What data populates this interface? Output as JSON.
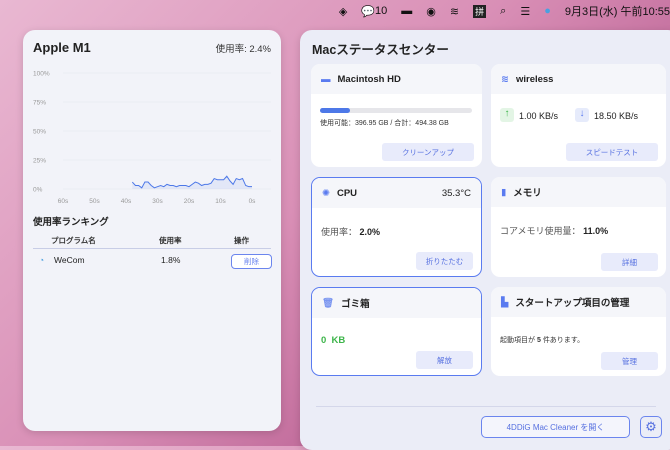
{
  "menubar": {
    "notif_count": "10",
    "clock": "9月3日(水) 午前10:55"
  },
  "left": {
    "title": "Apple M1",
    "usage": "使用率: 2.4%",
    "ranking_title": "使用率ランキング",
    "columns": [
      "プログラム名",
      "使用率",
      "操作"
    ],
    "rows": [
      {
        "name": "WeCom",
        "usage": "1.8%",
        "action": "削除"
      }
    ]
  },
  "chart_data": {
    "type": "area",
    "title": "Apple M1",
    "xlabel": "",
    "ylabel": "",
    "y_ticks": [
      "100%",
      "75%",
      "50%",
      "25%",
      "0%"
    ],
    "x_ticks": [
      "60s",
      "50s",
      "40s",
      "30s",
      "20s",
      "10s",
      "0s"
    ],
    "ylim": [
      0,
      100
    ],
    "xlim": [
      60,
      0
    ],
    "x": [
      38,
      37,
      36,
      35,
      34,
      33,
      32,
      31,
      30,
      29,
      28,
      27,
      26,
      25,
      24,
      23,
      22,
      21,
      20,
      19,
      18,
      17,
      16,
      15,
      14,
      13,
      12,
      11,
      10,
      9,
      8,
      7,
      6,
      5,
      4,
      3,
      2,
      1,
      0
    ],
    "values": [
      6,
      3,
      3,
      1,
      6,
      6,
      3,
      1,
      2,
      3,
      2,
      4,
      3,
      3,
      2,
      3,
      3,
      3,
      2,
      4,
      6,
      5,
      3,
      4,
      4,
      5,
      9,
      8,
      8,
      8,
      11,
      7,
      4,
      9,
      8,
      9,
      3,
      2,
      2
    ]
  },
  "right": {
    "title": "Macステータスセンター",
    "disk": {
      "name": "Macintosh HD",
      "used_fraction": 0.197,
      "info": "使用可能：396.95 GB / 合計：494.38 GB",
      "button": "クリーンアップ"
    },
    "wireless": {
      "name": "wireless",
      "up": "1.00 KB/s",
      "down": "18.50 KB/s",
      "button": "スピードテスト"
    },
    "cpu": {
      "name": "CPU",
      "temp": "35.3°C",
      "usage_label": "使用率：",
      "usage": "2.0%",
      "button": "折りたたむ"
    },
    "memory": {
      "name": "メモリ",
      "label": "コアメモリ使用量：",
      "value": "11.0%",
      "button": "詳細"
    },
    "trash": {
      "name": "ゴミ箱",
      "value": "0  KB",
      "button": "解放"
    },
    "startup": {
      "name": "スタートアップ項目の管理",
      "pre": "起動項目が",
      "count": "5",
      "post": "件あります。",
      "button": "管理"
    },
    "open_button": "4DDiG Mac Cleaner を開く"
  },
  "colors": {
    "accent": "#5a7bf0",
    "green": "#3db54a"
  }
}
